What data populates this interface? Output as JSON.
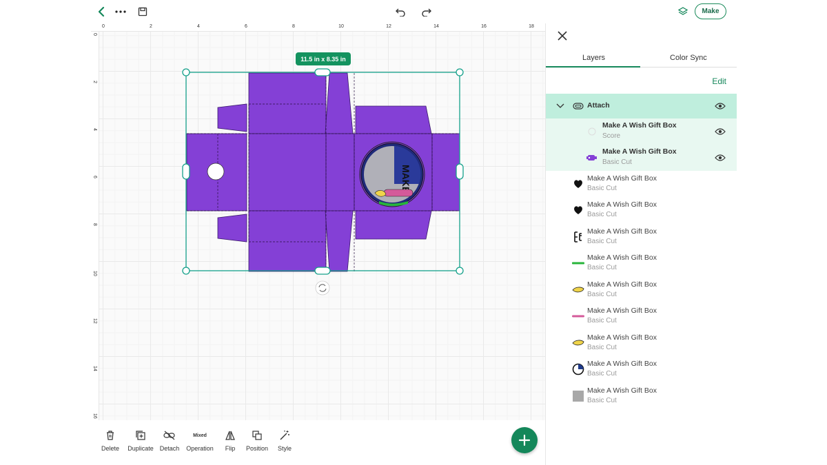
{
  "toolbar": {
    "make_label": "Make"
  },
  "canvas": {
    "ruler_top": [
      "0",
      "2",
      "4",
      "6",
      "8",
      "10",
      "12",
      "14",
      "16",
      "18"
    ],
    "ruler_left": [
      "0",
      "2",
      "4",
      "6",
      "8",
      "10",
      "12",
      "14",
      "16"
    ],
    "selection_size": "11.5 in x 8.35 in",
    "design_color": "#8440d6",
    "accent_color": "#14935f"
  },
  "bottom_tools": [
    {
      "label": "Delete",
      "icon": "trash-icon"
    },
    {
      "label": "Duplicate",
      "icon": "duplicate-icon"
    },
    {
      "label": "Detach",
      "icon": "detach-icon"
    },
    {
      "label": "Operation",
      "icon": "operation-icon",
      "value": "Mixed"
    },
    {
      "label": "Flip",
      "icon": "flip-icon"
    },
    {
      "label": "Position",
      "icon": "position-icon"
    },
    {
      "label": "Style",
      "icon": "magic-wand-icon"
    }
  ],
  "panel": {
    "tabs": [
      {
        "label": "Layers",
        "active": true
      },
      {
        "label": "Color Sync",
        "active": false
      }
    ],
    "edit_label": "Edit",
    "group": {
      "label": "Attach",
      "children": [
        {
          "title": "Make A Wish Gift Box",
          "sub": "Score",
          "color": "#dddddd"
        },
        {
          "title": "Make A Wish Gift Box",
          "sub": "Basic Cut",
          "color": "#8440d6"
        }
      ]
    },
    "layers": [
      {
        "title": "Make A Wish Gift Box",
        "sub": "Basic Cut",
        "icon": "heart-black-icon",
        "color": "#111111"
      },
      {
        "title": "Make A Wish Gift Box",
        "sub": "Basic Cut",
        "icon": "heart-black-icon",
        "color": "#111111"
      },
      {
        "title": "Make A Wish Gift Box",
        "sub": "Basic Cut",
        "icon": "text-glyph-icon",
        "color": "#111111"
      },
      {
        "title": "Make A Wish Gift Box",
        "sub": "Basic Cut",
        "icon": "green-line-icon",
        "color": "#27b53a"
      },
      {
        "title": "Make A Wish Gift Box",
        "sub": "Basic Cut",
        "icon": "yellow-drop-icon",
        "color": "#f0d44a"
      },
      {
        "title": "Make A Wish Gift Box",
        "sub": "Basic Cut",
        "icon": "pink-line-icon",
        "color": "#d45a9a"
      },
      {
        "title": "Make A Wish Gift Box",
        "sub": "Basic Cut",
        "icon": "yellow-drop-icon",
        "color": "#f0d44a"
      },
      {
        "title": "Make A Wish Gift Box",
        "sub": "Basic Cut",
        "icon": "circle-blue-icon",
        "color": "#1f3a8a"
      },
      {
        "title": "Make A Wish Gift Box",
        "sub": "Basic Cut",
        "icon": "gray-square-icon",
        "color": "#a8a8a8"
      }
    ]
  }
}
